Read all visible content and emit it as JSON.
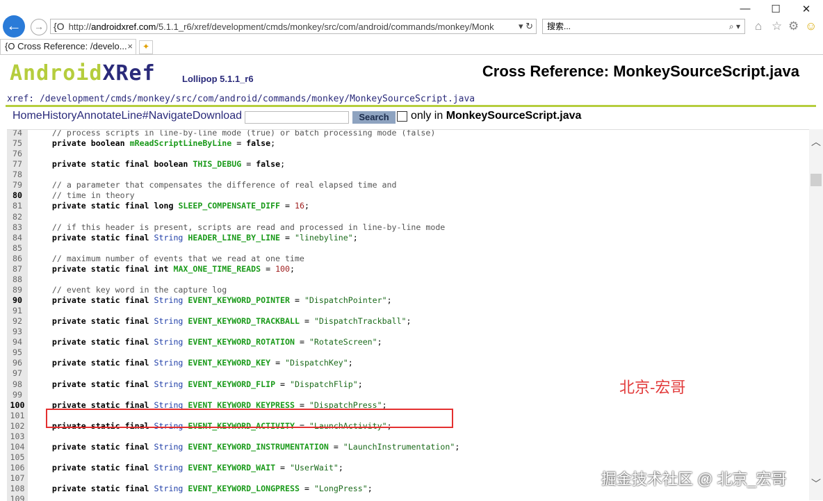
{
  "window": {
    "minimize": "—",
    "maximize": "☐",
    "close": "✕"
  },
  "browser": {
    "back_icon": "←",
    "forward_icon": "→",
    "address_favicon": "{O",
    "address_prefix": "http://",
    "address_host": "androidxref.com",
    "address_path": "/5.1.1_r6/xref/development/cmds/monkey/src/com/android/commands/monkey/Monk",
    "address_controls": "▾ ↻",
    "search_placeholder": "搜索...",
    "search_controls": "⌕ ▾",
    "toolbar_icons": [
      "home-icon",
      "star-icon",
      "gear-icon",
      "smiley-icon"
    ],
    "tab_favicon": "{O",
    "tab_title": "Cross Reference: /develo...",
    "tab_close": "×"
  },
  "header": {
    "logo_android": "Android",
    "logo_xref": "XRef",
    "version": "Lollipop 5.1.1_r6",
    "title": "Cross Reference: MonkeySourceScript.java",
    "xref_path": "xref: /development/cmds/monkey/src/com/android/commands/monkey/MonkeySourceScript.java"
  },
  "nav": {
    "links": [
      "Home",
      "History",
      "Annotate",
      "Line#",
      "Navigate",
      "Download"
    ],
    "search_label": "Search",
    "only_in_label": "only in",
    "only_in_file": "MonkeySourceScript.java"
  },
  "code_lines": [
    {
      "n": "74",
      "text": "    // process scripts in line-by-line mode (true) or batch processing mode (false)"
    },
    {
      "n": "75",
      "text": "    private boolean mReadScriptLineByLine = false;"
    },
    {
      "n": "76",
      "text": ""
    },
    {
      "n": "77",
      "text": "    private static final boolean THIS_DEBUG = false;"
    },
    {
      "n": "78",
      "text": ""
    },
    {
      "n": "79",
      "text": "    // a parameter that compensates the difference of real elapsed time and"
    },
    {
      "n": "80",
      "text": "    // time in theory"
    },
    {
      "n": "81",
      "text": "    private static final long SLEEP_COMPENSATE_DIFF = 16;"
    },
    {
      "n": "82",
      "text": ""
    },
    {
      "n": "83",
      "text": "    // if this header is present, scripts are read and processed in line-by-line mode"
    },
    {
      "n": "84",
      "text": "    private static final String HEADER_LINE_BY_LINE = \"linebyline\";"
    },
    {
      "n": "85",
      "text": ""
    },
    {
      "n": "86",
      "text": "    // maximum number of events that we read at one time"
    },
    {
      "n": "87",
      "text": "    private static final int MAX_ONE_TIME_READS = 100;"
    },
    {
      "n": "88",
      "text": ""
    },
    {
      "n": "89",
      "text": "    // event key word in the capture log"
    },
    {
      "n": "90",
      "text": "    private static final String EVENT_KEYWORD_POINTER = \"DispatchPointer\";"
    },
    {
      "n": "91",
      "text": ""
    },
    {
      "n": "92",
      "text": "    private static final String EVENT_KEYWORD_TRACKBALL = \"DispatchTrackball\";"
    },
    {
      "n": "93",
      "text": ""
    },
    {
      "n": "94",
      "text": "    private static final String EVENT_KEYWORD_ROTATION = \"RotateScreen\";"
    },
    {
      "n": "95",
      "text": ""
    },
    {
      "n": "96",
      "text": "    private static final String EVENT_KEYWORD_KEY = \"DispatchKey\";"
    },
    {
      "n": "97",
      "text": ""
    },
    {
      "n": "98",
      "text": "    private static final String EVENT_KEYWORD_FLIP = \"DispatchFlip\";"
    },
    {
      "n": "99",
      "text": ""
    },
    {
      "n": "100",
      "text": "    private static final String EVENT_KEYWORD_KEYPRESS = \"DispatchPress\";"
    },
    {
      "n": "101",
      "text": ""
    },
    {
      "n": "102",
      "text": "    private static final String EVENT_KEYWORD_ACTIVITY = \"LaunchActivity\";"
    },
    {
      "n": "103",
      "text": ""
    },
    {
      "n": "104",
      "text": "    private static final String EVENT_KEYWORD_INSTRUMENTATION = \"LaunchInstrumentation\";"
    },
    {
      "n": "105",
      "text": ""
    },
    {
      "n": "106",
      "text": "    private static final String EVENT_KEYWORD_WAIT = \"UserWait\";"
    },
    {
      "n": "107",
      "text": ""
    },
    {
      "n": "108",
      "text": "    private static final String EVENT_KEYWORD_LONGPRESS = \"LongPress\";"
    },
    {
      "n": "109",
      "text": ""
    }
  ],
  "bold_line_numbers": [
    "80",
    "90",
    "100"
  ],
  "watermark_red": "北京-宏哥",
  "watermark_white": "掘金技术社区 @ 北京_宏哥",
  "colors": {
    "logo_green": "#b5cd3d",
    "link_blue": "#2a2a7a",
    "highlight_red": "#e43030",
    "identifier_green": "#1a9a1a"
  }
}
